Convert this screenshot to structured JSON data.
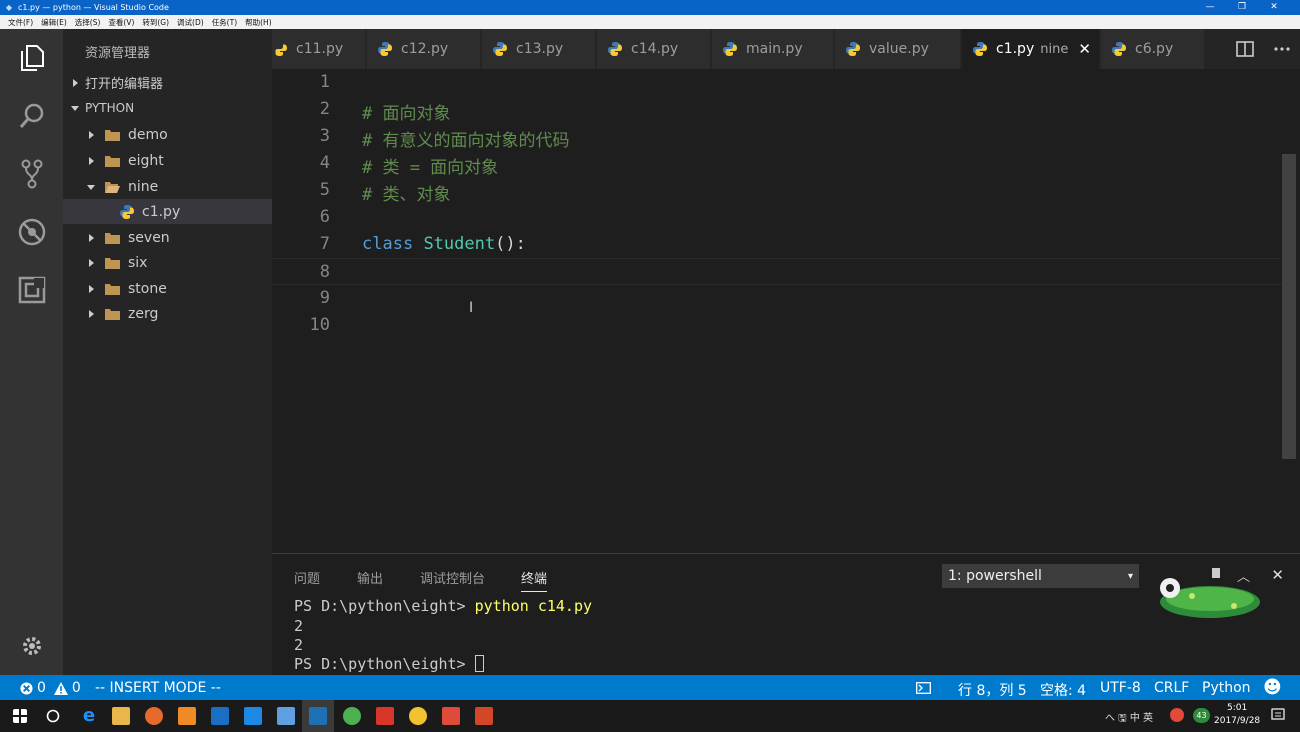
{
  "window": {
    "title": "c1.py — python — Visual Studio Code",
    "controls": [
      "—",
      "❐",
      "✕"
    ]
  },
  "menu": [
    "文件(F)",
    "编辑(E)",
    "选择(S)",
    "查看(V)",
    "转到(G)",
    "调试(D)",
    "任务(T)",
    "帮助(H)"
  ],
  "sidebar": {
    "title": "资源管理器",
    "open_editors": "打开的编辑器",
    "workspace": "PYTHON",
    "folders": [
      "demo",
      "eight",
      "nine",
      "seven",
      "six",
      "stone",
      "zerg"
    ],
    "open_folder": "nine",
    "selected_file": "c1.py"
  },
  "tabs": [
    {
      "label": "c11.py"
    },
    {
      "label": "c12.py"
    },
    {
      "label": "c13.py"
    },
    {
      "label": "c14.py"
    },
    {
      "label": "main.py"
    },
    {
      "label": "value.py"
    },
    {
      "label": "c1.py",
      "sub": "nine",
      "close": "✕",
      "active": true
    },
    {
      "label": "c6.py"
    }
  ],
  "editor": {
    "line_numbers": [
      "1",
      "2",
      "3",
      "4",
      "5",
      "6",
      "7",
      "8",
      "9",
      "10"
    ],
    "comments": [
      "# 面向对象",
      "# 有意义的面向对象的代码",
      "# 类 = 面向对象",
      "# 类、对象"
    ],
    "class_keyword": "class",
    "class_name": "Student",
    "class_suffix": "():",
    "cursor_glyph": "I"
  },
  "panel": {
    "tabs": [
      "问题",
      "输出",
      "调试控制台",
      "终端"
    ],
    "active_tab": "终端",
    "terminal_select": "1: powershell",
    "caret": "▾",
    "close": "✕",
    "maximize": "︿",
    "prompt1": "PS D:\\python\\eight> ",
    "cmd1": "python c14.py",
    "output": [
      "2",
      "2"
    ],
    "prompt2": "PS D:\\python\\eight> "
  },
  "statusbar": {
    "errors": "0",
    "warnings": "0",
    "mode": "-- INSERT MODE --",
    "position": "行 8，列 5",
    "spaces": "空格: 4",
    "encoding": "UTF-8",
    "eol": "CRLF",
    "language": "Python",
    "smiley": "☻"
  },
  "taskbar": {
    "tray": "へ 🖫 中 英",
    "badge": "43",
    "time": "5:01",
    "date": "2017/9/28"
  },
  "colors": {
    "accent": "#007acc",
    "comment": "#608b4e",
    "keyword": "#569cd6",
    "class": "#4ec9b0"
  }
}
